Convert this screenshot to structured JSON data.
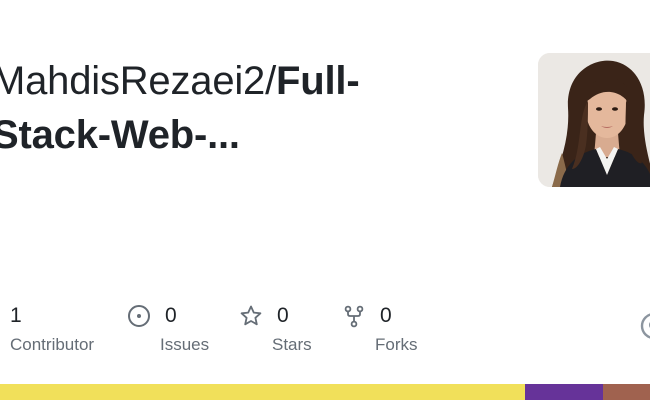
{
  "repo": {
    "owner_prefix": "MahdisRezaei2/",
    "name_line1": "Full-",
    "name_line2": "Stack-Web-..."
  },
  "stats": {
    "contributors": {
      "count": "1",
      "label": "Contributor"
    },
    "issues": {
      "count": "0",
      "label": "Issues",
      "icon": "issue-opened-icon"
    },
    "stars": {
      "count": "0",
      "label": "Stars",
      "icon": "star-icon"
    },
    "forks": {
      "count": "0",
      "label": "Forks",
      "icon": "repo-forked-icon"
    }
  },
  "language_bar": [
    {
      "color": "#f1e05a",
      "fraction": 0.808
    },
    {
      "color": "#663399",
      "fraction": 0.12
    },
    {
      "color": "#a0624f",
      "fraction": 0.072
    }
  ],
  "colors": {
    "text": "#1f2328",
    "muted": "#656d76"
  }
}
